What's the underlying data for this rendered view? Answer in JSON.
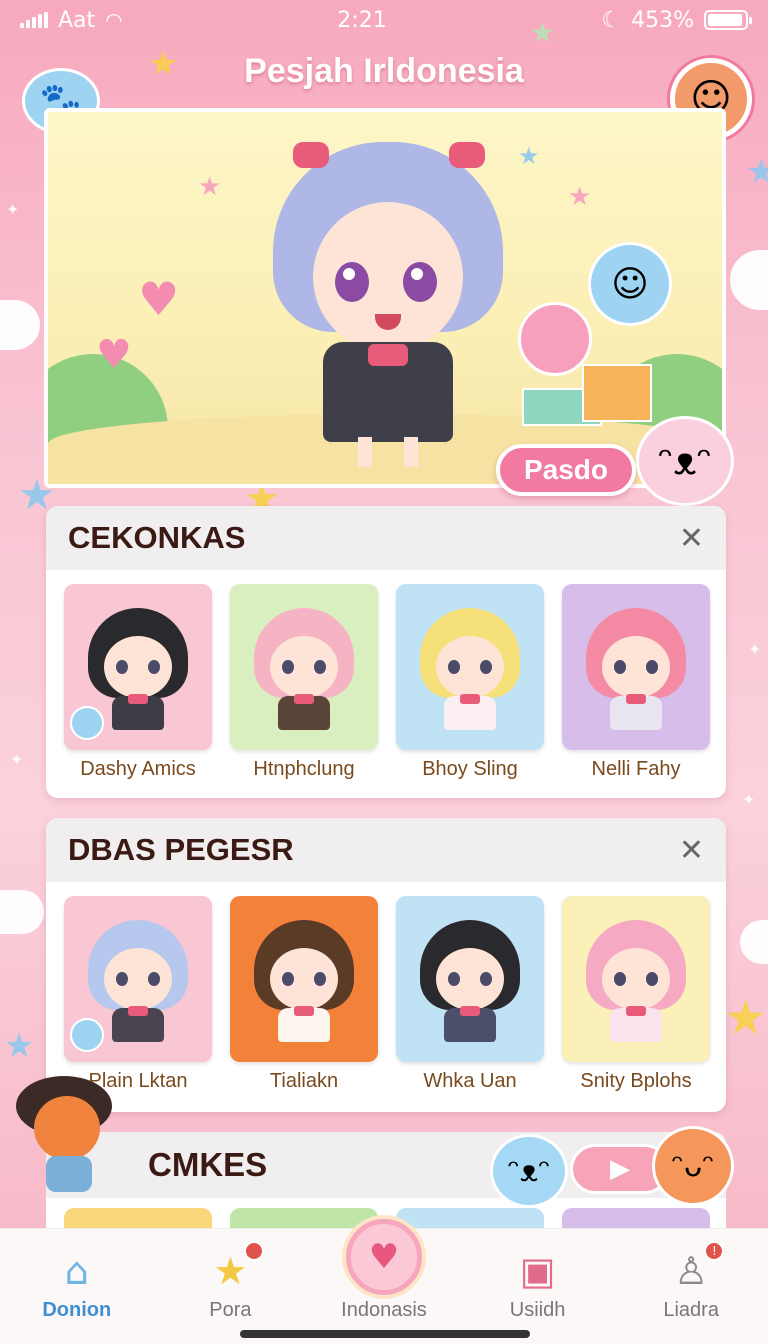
{
  "status_bar": {
    "carrier": "Aat",
    "time": "2:21",
    "battery": "453%"
  },
  "header": {
    "title": "Pesjah Irldonesia"
  },
  "hero": {
    "action_label": "Pasdo"
  },
  "sections": [
    {
      "title": "CEKONKAS",
      "cards": [
        {
          "name": "Dashy Amics",
          "bg": "#f9c6d3",
          "hair": "#2a2a2e",
          "outfit": "#3d3d46"
        },
        {
          "name": "Htnphclung",
          "bg": "#d9efbf",
          "hair": "#f6b3c4",
          "outfit": "#5a4438"
        },
        {
          "name": "Bhoy Sling",
          "bg": "#bfe3f4",
          "hair": "#f6e07a",
          "outfit": "#fbeff2"
        },
        {
          "name": "Nelli Fahy",
          "bg": "#d7bde9",
          "hair": "#f58aa5",
          "outfit": "#e9e6f0"
        }
      ]
    },
    {
      "title": "DBAS PEGESR",
      "cards": [
        {
          "name": "Plain Lktan",
          "bg": "#f9c6d3",
          "hair": "#b7c8ef",
          "outfit": "#4a4450"
        },
        {
          "name": "Tialiakn",
          "bg": "#f2823a",
          "hair": "#5b3a26",
          "outfit": "#fbf5ee"
        },
        {
          "name": "Whka Uan",
          "bg": "#bfe3f4",
          "hair": "#2a2a2e",
          "outfit": "#4b4f6a"
        },
        {
          "name": "Snity Bplohs",
          "bg": "#fbf0b8",
          "hair": "#f6a9c2",
          "outfit": "#fbe4ee"
        }
      ]
    }
  ],
  "section3": {
    "title": "CMKES",
    "peek_colors": [
      "#f9d77a",
      "#bfe6a8",
      "#bfe3f4",
      "#d7bde9"
    ]
  },
  "bottom_nav": [
    {
      "label": "Donion",
      "icon": "home-icon",
      "active": true
    },
    {
      "label": "Pora",
      "icon": "star-icon",
      "badge": true
    },
    {
      "label": "Indonasis",
      "icon": "heart-icon",
      "center": true
    },
    {
      "label": "Usiidh",
      "icon": "bag-icon"
    },
    {
      "label": "Liadra",
      "icon": "profile-icon",
      "badge": true
    }
  ],
  "colors": {
    "accent": "#f27aa0",
    "nav_active": "#3f8fd1",
    "title_text": "#3a1a12"
  }
}
